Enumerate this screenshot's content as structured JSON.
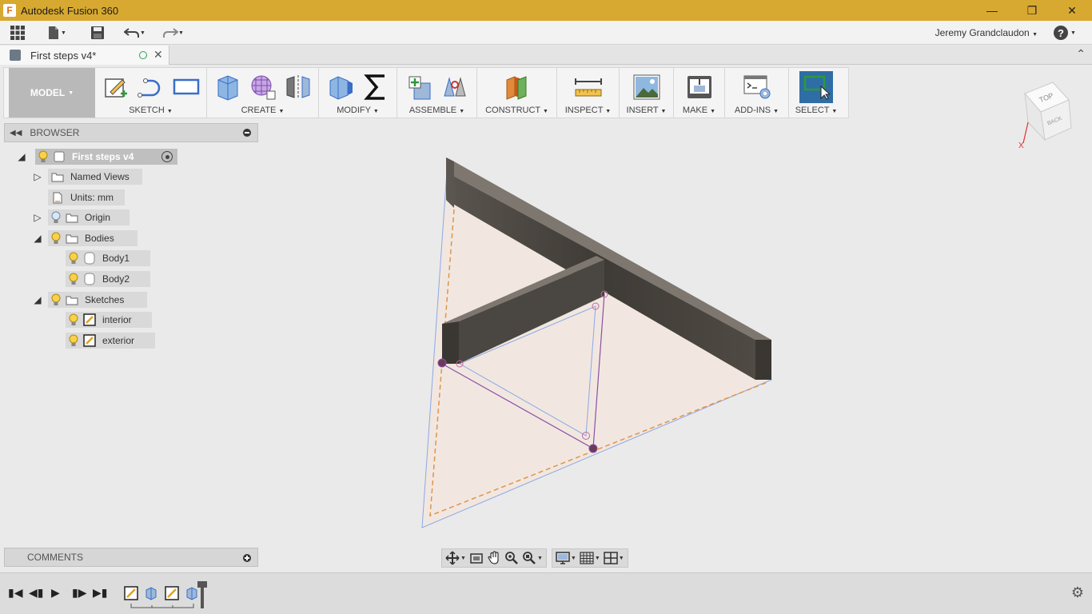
{
  "window": {
    "title": "Autodesk Fusion 360",
    "controls": [
      "minimize",
      "restore",
      "close"
    ]
  },
  "quick_access": {
    "user_name": "Jeremy Grandclaudon",
    "help_label": "?"
  },
  "document_tab": {
    "label": "First steps v4*"
  },
  "toolbar": {
    "workspace_label": "MODEL",
    "groups": [
      {
        "label": "SKETCH",
        "icons": [
          "create-sketch-icon",
          "line-icon",
          "rectangle-icon"
        ]
      },
      {
        "label": "CREATE",
        "icons": [
          "extrude-icon",
          "form-icon",
          "mirror-icon"
        ]
      },
      {
        "label": "MODIFY",
        "icons": [
          "press-pull-icon",
          "parameters-icon"
        ]
      },
      {
        "label": "ASSEMBLE",
        "icons": [
          "new-component-icon",
          "joint-icon"
        ]
      },
      {
        "label": "CONSTRUCT",
        "icons": [
          "offset-plane-icon"
        ]
      },
      {
        "label": "INSPECT",
        "icons": [
          "measure-icon"
        ]
      },
      {
        "label": "INSERT",
        "icons": [
          "insert-image-icon"
        ]
      },
      {
        "label": "MAKE",
        "icons": [
          "3d-print-icon"
        ]
      },
      {
        "label": "ADD-INS",
        "icons": [
          "scripts-icon"
        ]
      },
      {
        "label": "SELECT",
        "icons": [
          "select-icon"
        ]
      }
    ]
  },
  "browser": {
    "title": "BROWSER",
    "root": {
      "label": "First steps v4"
    },
    "items": [
      {
        "label": "Named Views"
      },
      {
        "label": "Units: mm"
      },
      {
        "label": "Origin"
      },
      {
        "label": "Bodies"
      },
      {
        "label": "Body1"
      },
      {
        "label": "Body2"
      },
      {
        "label": "Sketches"
      },
      {
        "label": "interior"
      },
      {
        "label": "exterior"
      }
    ]
  },
  "comments": {
    "title": "COMMENTS"
  },
  "viewcube": {
    "top_label": "TOP",
    "back_label": "BACK",
    "axis_label": "X"
  },
  "colors": {
    "title_bar": "#d8a930",
    "select_active": "#2f6da5",
    "body_dark": "#4a4641",
    "sketch_line": "#8a4fa6",
    "profile_fill": "#f4e6dc",
    "dashed_orange": "#e0944a",
    "light_blue": "#8aa8e6"
  },
  "timeline": {
    "controls": [
      "go-to-start",
      "previous-step",
      "play",
      "next-step",
      "go-to-end"
    ],
    "features": [
      "sketch-feature-icon",
      "extrude-feature-icon",
      "sketch-feature-icon",
      "extrude-feature-icon"
    ]
  }
}
